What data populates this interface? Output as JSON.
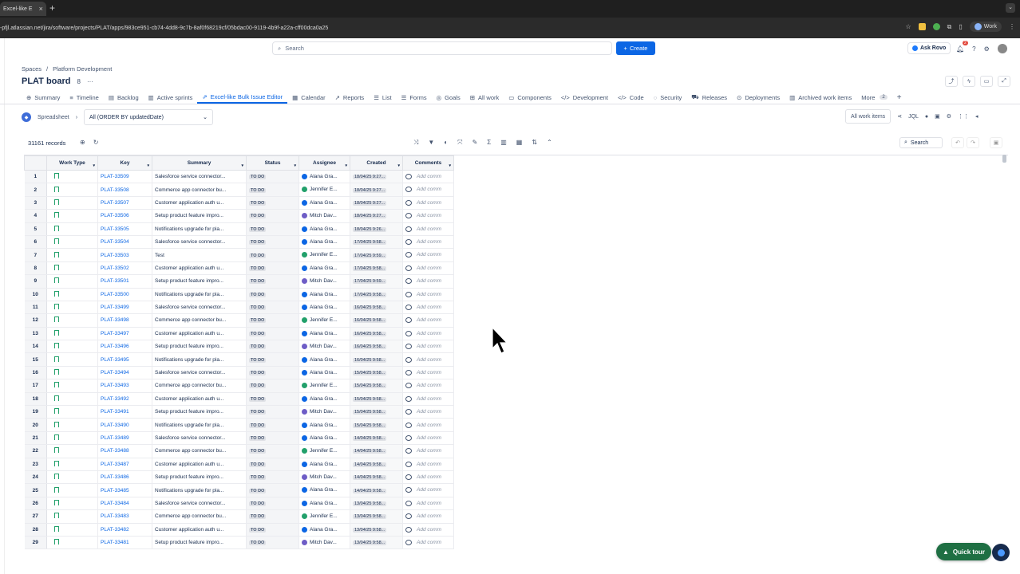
{
  "browser": {
    "tab_title": "Excel-like E",
    "url": "-pfjl.atlassian.net/jira/software/projects/PLAT/apps/983ce951-cb74-4dd8-9c7b-8af0f68219cf/05bdac00-9119-4b9f-a22a-cff00dca0a25",
    "profile": "Work",
    "close": "×",
    "new_tab": "+",
    "tab_menu": "⌄"
  },
  "topbar": {
    "search_placeholder": "Search",
    "create_label": "Create",
    "ask_rovo": "Ask Rovo",
    "notif_count": "2"
  },
  "breadcrumb": {
    "spaces": "Spaces",
    "sep": "/",
    "project": "Platform Development"
  },
  "board": {
    "title": "PLAT board",
    "people_icon": "8",
    "more": "···"
  },
  "tabs": [
    {
      "icon": "⊕",
      "label": "Summary"
    },
    {
      "icon": "≡",
      "label": "Timeline"
    },
    {
      "icon": "▤",
      "label": "Backlog"
    },
    {
      "icon": "▥",
      "label": "Active sprints"
    },
    {
      "icon": "⇗",
      "label": "Excel-like Bulk Issue Editor"
    },
    {
      "icon": "▦",
      "label": "Calendar"
    },
    {
      "icon": "↗",
      "label": "Reports"
    },
    {
      "icon": "☰",
      "label": "List"
    },
    {
      "icon": "☰",
      "label": "Forms"
    },
    {
      "icon": "◎",
      "label": "Goals"
    },
    {
      "icon": "⊞",
      "label": "All work"
    },
    {
      "icon": "▭",
      "label": "Components"
    },
    {
      "icon": "</>",
      "label": "Development"
    },
    {
      "icon": "</>",
      "label": "Code"
    },
    {
      "icon": "◌",
      "label": "Security"
    },
    {
      "icon": "⛟",
      "label": "Releases"
    },
    {
      "icon": "⊙",
      "label": "Deployments"
    },
    {
      "icon": "▥",
      "label": "Archived work items"
    }
  ],
  "tabs_more": {
    "label": "More",
    "count": "2",
    "add": "+"
  },
  "spreadsheet_bar": {
    "name": "Spreadsheet",
    "arrow": "›",
    "query": "All (ORDER BY updatedDate)",
    "caret": "⌄",
    "all_work_items": "All work items",
    "jql": "JQL"
  },
  "grid_toolbar": {
    "records": "31161 records",
    "search": "Search"
  },
  "columns": [
    "Work Type",
    "Key",
    "Summary",
    "Status",
    "Assignee",
    "Created",
    "Comments"
  ],
  "rows": [
    {
      "n": "1",
      "key": "PLAT-33509",
      "summary": "Salesforce service connector...",
      "status": "TO DO",
      "assignee": "Alana Gra...",
      "who": "alana",
      "created": "18/04/25 9:27...",
      "comment": "Add comm"
    },
    {
      "n": "2",
      "key": "PLAT-33508",
      "summary": "Commerce app connector bu...",
      "status": "TO DO",
      "assignee": "Jennifer E...",
      "who": "jen",
      "created": "18/04/25 9:27...",
      "comment": "Add comm"
    },
    {
      "n": "3",
      "key": "PLAT-33507",
      "summary": "Customer application auth u...",
      "status": "TO DO",
      "assignee": "Alana Gra...",
      "who": "alana",
      "created": "18/04/25 9:27...",
      "comment": "Add comm"
    },
    {
      "n": "4",
      "key": "PLAT-33506",
      "summary": "Setup product feature impro...",
      "status": "TO DO",
      "assignee": "Mitch Dav...",
      "who": "mitch",
      "created": "18/04/25 9:27...",
      "comment": "Add comm"
    },
    {
      "n": "5",
      "key": "PLAT-33505",
      "summary": "Notifications upgrade for pla...",
      "status": "TO DO",
      "assignee": "Alana Gra...",
      "who": "alana",
      "created": "18/04/25 9:26...",
      "comment": "Add comm"
    },
    {
      "n": "6",
      "key": "PLAT-33504",
      "summary": "Salesforce service connector...",
      "status": "TO DO",
      "assignee": "Alana Gra...",
      "who": "alana",
      "created": "17/04/25 9:58...",
      "comment": "Add comm"
    },
    {
      "n": "7",
      "key": "PLAT-33503",
      "summary": "Test",
      "status": "TO DO",
      "assignee": "Jennifer E...",
      "who": "jen",
      "created": "17/04/25 9:59...",
      "comment": "Add comm"
    },
    {
      "n": "8",
      "key": "PLAT-33502",
      "summary": "Customer application auth u...",
      "status": "TO DO",
      "assignee": "Alana Gra...",
      "who": "alana",
      "created": "17/04/25 9:58...",
      "comment": "Add comm"
    },
    {
      "n": "9",
      "key": "PLAT-33501",
      "summary": "Setup product feature impro...",
      "status": "TO DO",
      "assignee": "Mitch Dav...",
      "who": "mitch",
      "created": "17/04/25 9:59...",
      "comment": "Add comm"
    },
    {
      "n": "10",
      "key": "PLAT-33500",
      "summary": "Notifications upgrade for pla...",
      "status": "TO DO",
      "assignee": "Alana Gra...",
      "who": "alana",
      "created": "17/04/25 9:58...",
      "comment": "Add comm"
    },
    {
      "n": "11",
      "key": "PLAT-33499",
      "summary": "Salesforce service connector...",
      "status": "TO DO",
      "assignee": "Alana Gra...",
      "who": "alana",
      "created": "16/04/25 9:58...",
      "comment": "Add comm"
    },
    {
      "n": "12",
      "key": "PLAT-33498",
      "summary": "Commerce app connector bu...",
      "status": "TO DO",
      "assignee": "Jennifer E...",
      "who": "jen",
      "created": "16/04/25 9:58...",
      "comment": "Add comm"
    },
    {
      "n": "13",
      "key": "PLAT-33497",
      "summary": "Customer application auth u...",
      "status": "TO DO",
      "assignee": "Alana Gra...",
      "who": "alana",
      "created": "16/04/25 9:58...",
      "comment": "Add comm"
    },
    {
      "n": "14",
      "key": "PLAT-33496",
      "summary": "Setup product feature impro...",
      "status": "TO DO",
      "assignee": "Mitch Dav...",
      "who": "mitch",
      "created": "16/04/25 9:58...",
      "comment": "Add comm"
    },
    {
      "n": "15",
      "key": "PLAT-33495",
      "summary": "Notifications upgrade for pla...",
      "status": "TO DO",
      "assignee": "Alana Gra...",
      "who": "alana",
      "created": "16/04/25 9:58...",
      "comment": "Add comm"
    },
    {
      "n": "16",
      "key": "PLAT-33494",
      "summary": "Salesforce service connector...",
      "status": "TO DO",
      "assignee": "Alana Gra...",
      "who": "alana",
      "created": "15/04/25 9:58...",
      "comment": "Add comm"
    },
    {
      "n": "17",
      "key": "PLAT-33493",
      "summary": "Commerce app connector bu...",
      "status": "TO DO",
      "assignee": "Jennifer E...",
      "who": "jen",
      "created": "15/04/25 9:58...",
      "comment": "Add comm"
    },
    {
      "n": "18",
      "key": "PLAT-33492",
      "summary": "Customer application auth u...",
      "status": "TO DO",
      "assignee": "Alana Gra...",
      "who": "alana",
      "created": "15/04/25 9:58...",
      "comment": "Add comm"
    },
    {
      "n": "19",
      "key": "PLAT-33491",
      "summary": "Setup product feature impro...",
      "status": "TO DO",
      "assignee": "Mitch Dav...",
      "who": "mitch",
      "created": "15/04/25 9:58...",
      "comment": "Add comm"
    },
    {
      "n": "20",
      "key": "PLAT-33490",
      "summary": "Notifications upgrade for pla...",
      "status": "TO DO",
      "assignee": "Alana Gra...",
      "who": "alana",
      "created": "15/04/25 9:58...",
      "comment": "Add comm"
    },
    {
      "n": "21",
      "key": "PLAT-33489",
      "summary": "Salesforce service connector...",
      "status": "TO DO",
      "assignee": "Alana Gra...",
      "who": "alana",
      "created": "14/04/25 9:58...",
      "comment": "Add comm"
    },
    {
      "n": "22",
      "key": "PLAT-33488",
      "summary": "Commerce app connector bu...",
      "status": "TO DO",
      "assignee": "Jennifer E...",
      "who": "jen",
      "created": "14/04/25 9:58...",
      "comment": "Add comm"
    },
    {
      "n": "23",
      "key": "PLAT-33487",
      "summary": "Customer application auth u...",
      "status": "TO DO",
      "assignee": "Alana Gra...",
      "who": "alana",
      "created": "14/04/25 9:58...",
      "comment": "Add comm"
    },
    {
      "n": "24",
      "key": "PLAT-33486",
      "summary": "Setup product feature impro...",
      "status": "TO DO",
      "assignee": "Mitch Dav...",
      "who": "mitch",
      "created": "14/04/25 9:58...",
      "comment": "Add comm"
    },
    {
      "n": "25",
      "key": "PLAT-33485",
      "summary": "Notifications upgrade for pla...",
      "status": "TO DO",
      "assignee": "Alana Gra...",
      "who": "alana",
      "created": "14/04/25 9:58...",
      "comment": "Add comm"
    },
    {
      "n": "26",
      "key": "PLAT-33484",
      "summary": "Salesforce service connector...",
      "status": "TO DO",
      "assignee": "Alana Gra...",
      "who": "alana",
      "created": "13/04/25 9:58...",
      "comment": "Add comm"
    },
    {
      "n": "27",
      "key": "PLAT-33483",
      "summary": "Commerce app connector bu...",
      "status": "TO DO",
      "assignee": "Jennifer E...",
      "who": "jen",
      "created": "13/04/25 9:58...",
      "comment": "Add comm"
    },
    {
      "n": "28",
      "key": "PLAT-33482",
      "summary": "Customer application auth u...",
      "status": "TO DO",
      "assignee": "Alana Gra...",
      "who": "alana",
      "created": "13/04/25 9:58...",
      "comment": "Add comm"
    },
    {
      "n": "29",
      "key": "PLAT-33481",
      "summary": "Setup product feature impro...",
      "status": "TO DO",
      "assignee": "Mitch Dav...",
      "who": "mitch",
      "created": "13/04/25 9:58...",
      "comment": "Add comm"
    }
  ],
  "quick_tour": "Quick tour",
  "colors": {
    "accent": "#0c66e4",
    "quicktour": "#1f6f43",
    "work_type": "#22a06b"
  }
}
